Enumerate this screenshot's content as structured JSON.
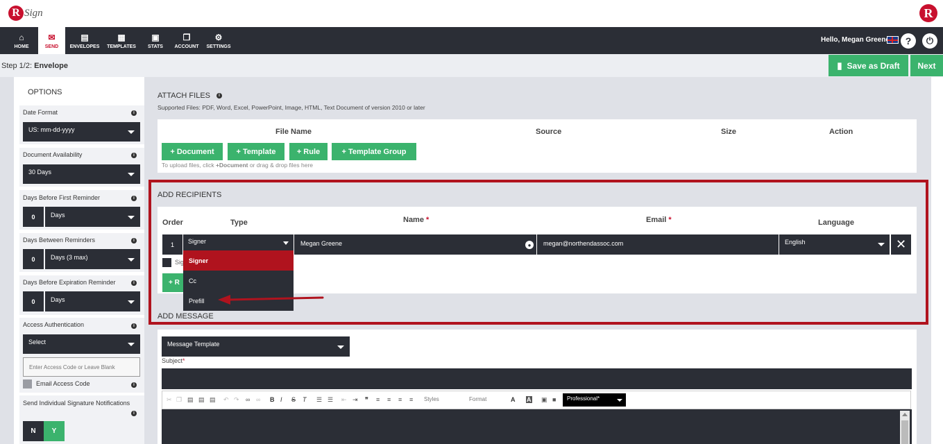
{
  "header": {
    "logo_letter": "R",
    "logo_text": "Sign"
  },
  "nav": {
    "items": [
      {
        "label": "HOME",
        "icon": "⌂"
      },
      {
        "label": "SEND",
        "icon": "✉"
      },
      {
        "label": "ENVELOPES",
        "icon": "▤"
      },
      {
        "label": "TEMPLATES",
        "icon": "▦"
      },
      {
        "label": "STATS",
        "icon": "▣"
      },
      {
        "label": "ACCOUNT",
        "icon": "❐"
      },
      {
        "label": "SETTINGS",
        "icon": "⚙"
      }
    ],
    "greeting": "Hello, Megan Greene",
    "help": "?",
    "power": "⏻"
  },
  "step": {
    "prefix": "Step 1/2:",
    "title": "Envelope",
    "save_draft": "Save as Draft",
    "next": "Next"
  },
  "options": {
    "title": "OPTIONS",
    "date_format": {
      "label": "Date Format",
      "value": "US: mm-dd-yyyy"
    },
    "availability": {
      "label": "Document Availability",
      "value": "30 Days"
    },
    "first_reminder": {
      "label": "Days Before First Reminder",
      "num": "0",
      "unit": "Days"
    },
    "between": {
      "label": "Days Between Reminders",
      "num": "0",
      "unit": "Days (3 max)"
    },
    "expiration": {
      "label": "Days Before Expiration Reminder",
      "num": "0",
      "unit": "Days"
    },
    "access": {
      "label": "Access Authentication",
      "value": "Select",
      "placeholder": "Enter Access Code or Leave Blank",
      "email_code": "Email Access Code"
    },
    "notifications": {
      "label": "Send Individual Signature Notifications",
      "no": "N",
      "yes": "Y"
    }
  },
  "attach": {
    "title": "ATTACH FILES",
    "supported": "Supported Files: PDF, Word, Excel, PowerPoint, Image, HTML, Text Document of version 2010 or later",
    "columns": [
      "File Name",
      "Source",
      "Size",
      "Action"
    ],
    "buttons": [
      "+ Document",
      "+ Template",
      "+ Rule",
      "+ Template Group"
    ],
    "hint_pre": "To upload files, click ",
    "hint_bold": "+Document",
    "hint_post": " or drag & drop files here"
  },
  "recipients": {
    "title": "ADD RECIPIENTS",
    "columns": {
      "order": "Order",
      "type": "Type",
      "name": "Name",
      "email": "Email",
      "language": "Language"
    },
    "row": {
      "order": "1",
      "type": "Signer",
      "name": "Megan Greene",
      "email": "megan@northendassoc.com",
      "language": "English"
    },
    "menu": [
      "Signer",
      "Cc",
      "Prefill"
    ],
    "partial_checkbox_label": "Sig",
    "partial_button": "+ R"
  },
  "message": {
    "title": "ADD MESSAGE",
    "template": "Message Template",
    "subject_label": "Subject",
    "styles": "Styles",
    "format": "Format",
    "style_select": "Professional*"
  },
  "colors": {
    "accent_red": "#c8102e",
    "green": "#3bb36d",
    "dark": "#2b2e36",
    "highlight": "#b0131e"
  }
}
